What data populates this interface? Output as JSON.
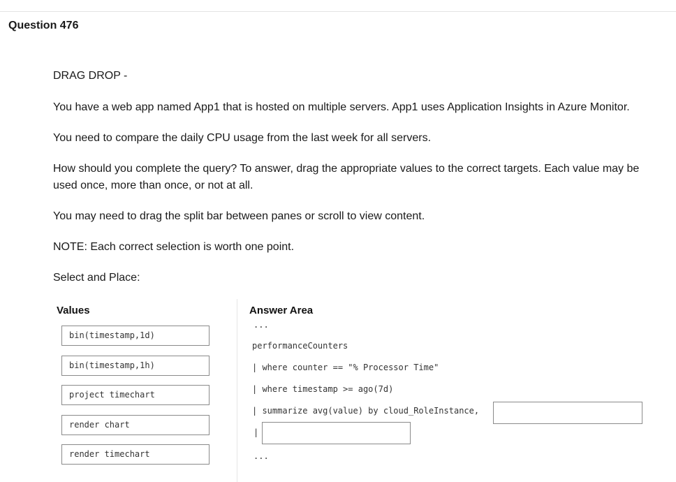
{
  "question": {
    "title": "Question 476"
  },
  "body": {
    "heading": "DRAG DROP -",
    "scenario": "You have a web app named App1 that is hosted on multiple servers. App1 uses Application Insights in Azure Monitor.",
    "requirement": "You need to compare the daily CPU usage from the last week for all servers.",
    "instructions": "How should you complete the query? To answer, drag the appropriate values to the correct targets. Each value may be used once, more than once, or not at all.",
    "scroll_note": "You may need to drag the split bar between panes or scroll to view content.",
    "note": "NOTE: Each correct selection is worth one point.",
    "select_label": "Select and Place:"
  },
  "exhibit": {
    "values_heading": "Values",
    "answer_heading": "Answer Area",
    "values": [
      "bin(timestamp,1d)",
      "bin(timestamp,1h)",
      "project timechart",
      "render chart",
      "render timechart"
    ],
    "query": {
      "ellipsis_top": "...",
      "line1": "performanceCounters",
      "line2": "| where counter == \"% Processor Time\"",
      "line3": "| where timestamp >= ago(7d)",
      "line4": "| summarize avg(value) by cloud_RoleInstance,",
      "line5_prefix": "|",
      "ellipsis_bottom": "..."
    }
  }
}
